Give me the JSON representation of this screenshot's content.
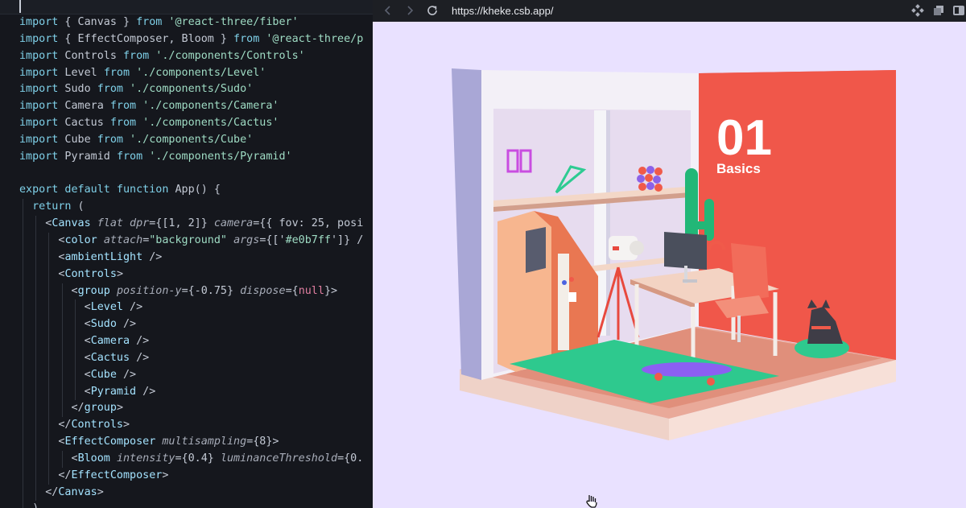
{
  "editor": {
    "lines": [
      [
        [
          "kw",
          "import"
        ],
        [
          "pl",
          " { Canvas } "
        ],
        [
          "kw",
          "from"
        ],
        [
          "str",
          " '@react-three/fiber'"
        ]
      ],
      [
        [
          "kw",
          "import"
        ],
        [
          "pl",
          " { EffectComposer, Bloom } "
        ],
        [
          "kw",
          "from"
        ],
        [
          "str",
          " '@react-three/p"
        ]
      ],
      [
        [
          "kw",
          "import"
        ],
        [
          "pl",
          " Controls "
        ],
        [
          "kw",
          "from"
        ],
        [
          "str",
          " './components/Controls'"
        ]
      ],
      [
        [
          "kw",
          "import"
        ],
        [
          "pl",
          " Level "
        ],
        [
          "kw",
          "from"
        ],
        [
          "str",
          " './components/Level'"
        ]
      ],
      [
        [
          "kw",
          "import"
        ],
        [
          "pl",
          " Sudo "
        ],
        [
          "kw",
          "from"
        ],
        [
          "str",
          " './components/Sudo'"
        ]
      ],
      [
        [
          "kw",
          "import"
        ],
        [
          "pl",
          " Camera "
        ],
        [
          "kw",
          "from"
        ],
        [
          "str",
          " './components/Camera'"
        ]
      ],
      [
        [
          "kw",
          "import"
        ],
        [
          "pl",
          " Cactus "
        ],
        [
          "kw",
          "from"
        ],
        [
          "str",
          " './components/Cactus'"
        ]
      ],
      [
        [
          "kw",
          "import"
        ],
        [
          "pl",
          " Cube "
        ],
        [
          "kw",
          "from"
        ],
        [
          "str",
          " './components/Cube'"
        ]
      ],
      [
        [
          "kw",
          "import"
        ],
        [
          "pl",
          " Pyramid "
        ],
        [
          "kw",
          "from"
        ],
        [
          "str",
          " './components/Pyramid'"
        ]
      ],
      [],
      [
        [
          "kw",
          "export default function"
        ],
        [
          "pl",
          " App() {"
        ]
      ],
      [
        [
          "pl",
          "  "
        ],
        [
          "kw",
          "return"
        ],
        [
          "pl",
          " ("
        ]
      ],
      [
        [
          "pl",
          "    <"
        ],
        [
          "tag",
          "Canvas"
        ],
        [
          "pl",
          " "
        ],
        [
          "attr",
          "flat dpr"
        ],
        [
          "pl",
          "={[1, 2]} "
        ],
        [
          "attr",
          "camera"
        ],
        [
          "pl",
          "={{ fov: 25, posi"
        ]
      ],
      [
        [
          "pl",
          "      <"
        ],
        [
          "tag",
          "color"
        ],
        [
          "pl",
          " "
        ],
        [
          "attr",
          "attach"
        ],
        [
          "pl",
          "="
        ],
        [
          "str",
          "\"background\""
        ],
        [
          "pl",
          " "
        ],
        [
          "attr",
          "args"
        ],
        [
          "pl",
          "={['"
        ],
        [
          "str",
          "#e0b7ff"
        ],
        [
          "pl",
          "']} /"
        ]
      ],
      [
        [
          "pl",
          "      <"
        ],
        [
          "tag",
          "ambientLight"
        ],
        [
          "pl",
          " />"
        ]
      ],
      [
        [
          "pl",
          "      <"
        ],
        [
          "tag",
          "Controls"
        ],
        [
          "pl",
          ">"
        ]
      ],
      [
        [
          "pl",
          "        <"
        ],
        [
          "tag",
          "group"
        ],
        [
          "pl",
          " "
        ],
        [
          "attr",
          "position-y"
        ],
        [
          "pl",
          "={-0.75} "
        ],
        [
          "attr",
          "dispose"
        ],
        [
          "pl",
          "={"
        ],
        [
          "nul",
          "null"
        ],
        [
          "pl",
          "}>"
        ]
      ],
      [
        [
          "pl",
          "          <"
        ],
        [
          "tag",
          "Level"
        ],
        [
          "pl",
          " />"
        ]
      ],
      [
        [
          "pl",
          "          <"
        ],
        [
          "tag",
          "Sudo"
        ],
        [
          "pl",
          " />"
        ]
      ],
      [
        [
          "pl",
          "          <"
        ],
        [
          "tag",
          "Camera"
        ],
        [
          "pl",
          " />"
        ]
      ],
      [
        [
          "pl",
          "          <"
        ],
        [
          "tag",
          "Cactus"
        ],
        [
          "pl",
          " />"
        ]
      ],
      [
        [
          "pl",
          "          <"
        ],
        [
          "tag",
          "Cube"
        ],
        [
          "pl",
          " />"
        ]
      ],
      [
        [
          "pl",
          "          <"
        ],
        [
          "tag",
          "Pyramid"
        ],
        [
          "pl",
          " />"
        ]
      ],
      [
        [
          "pl",
          "        </"
        ],
        [
          "tag",
          "group"
        ],
        [
          "pl",
          ">"
        ]
      ],
      [
        [
          "pl",
          "      </"
        ],
        [
          "tag",
          "Controls"
        ],
        [
          "pl",
          ">"
        ]
      ],
      [
        [
          "pl",
          "      <"
        ],
        [
          "tag",
          "EffectComposer"
        ],
        [
          "pl",
          " "
        ],
        [
          "attr",
          "multisampling"
        ],
        [
          "pl",
          "={8}>"
        ]
      ],
      [
        [
          "pl",
          "        <"
        ],
        [
          "tag",
          "Bloom"
        ],
        [
          "pl",
          " "
        ],
        [
          "attr",
          "intensity"
        ],
        [
          "pl",
          "={0.4} "
        ],
        [
          "attr",
          "luminanceThreshold"
        ],
        [
          "pl",
          "={0."
        ]
      ],
      [
        [
          "pl",
          "      </"
        ],
        [
          "tag",
          "EffectComposer"
        ],
        [
          "pl",
          ">"
        ]
      ],
      [
        [
          "pl",
          "    </"
        ],
        [
          "tag",
          "Canvas"
        ],
        [
          "pl",
          ">"
        ]
      ],
      [
        [
          "pl",
          "  )"
        ]
      ]
    ]
  },
  "browser": {
    "url": "https://kheke.csb.app/",
    "scene": {
      "number": "01",
      "caption": "Basics",
      "background_color": "#e9e1ff",
      "accent_color": "#f0564a"
    }
  },
  "colors": {
    "keyword": "#7fd0e8",
    "string": "#9fdcc4",
    "tag": "#a4e3ff",
    "null": "#e07ea0"
  },
  "icons": [
    "back-arrow-icon",
    "forward-arrow-icon",
    "reload-icon",
    "extension-icon",
    "copy-window-icon",
    "panel-icon",
    "hand-cursor-icon"
  ]
}
